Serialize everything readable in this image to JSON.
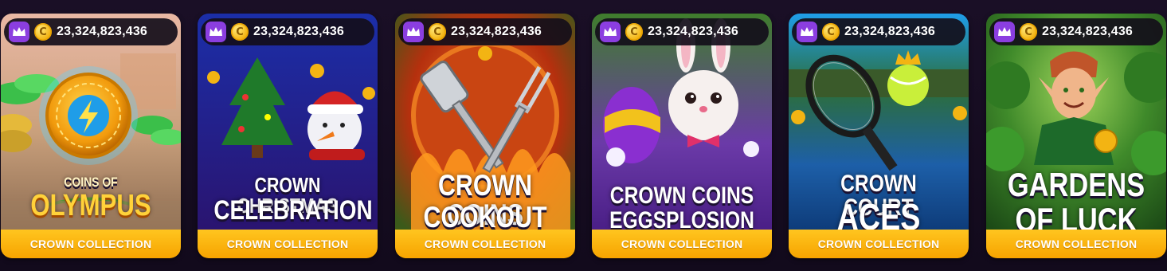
{
  "balance_icons": {
    "badge": "crown-icon",
    "currency": "coin-icon",
    "currency_symbol": "C"
  },
  "colors": {
    "accent_purple": "#8b3ee0",
    "footer_yellow": "#ffc51f",
    "coin_gold": "#f3b413",
    "background": "#140b1f"
  },
  "games": [
    {
      "id": "olympus",
      "title_top": "COINS OF",
      "title_main": "OLYMPUS",
      "balance": "23,324,823,436",
      "collection_label": "CROWN COLLECTION"
    },
    {
      "id": "christmas",
      "title_line1": "CROWN CHRISTMAS",
      "title_line2": "CELEBRATION",
      "balance": "23,324,823,436",
      "collection_label": "CROWN COLLECTION"
    },
    {
      "id": "cookout",
      "title_line1": "CROWN COINS",
      "title_line2": "COOKOUT",
      "balance": "23,324,823,436",
      "collection_label": "CROWN COLLECTION"
    },
    {
      "id": "eggsplosion",
      "title_line1": "CROWN COINS",
      "title_line2": "EGGSPLOSION",
      "balance": "23,324,823,436",
      "collection_label": "CROWN COLLECTION"
    },
    {
      "id": "tennis",
      "title_line1": "CROWN COURT",
      "title_line2": "ACES",
      "balance": "23,324,823,436",
      "collection_label": "CROWN COLLECTION"
    },
    {
      "id": "gardens",
      "title_line1": "GARDENS",
      "title_line2": "OF LUCK",
      "balance": "23,324,823,436",
      "collection_label": "CROWN COLLECTION"
    }
  ]
}
